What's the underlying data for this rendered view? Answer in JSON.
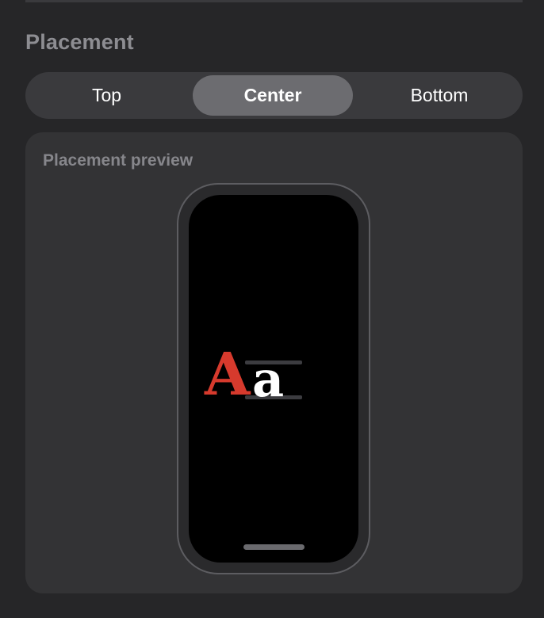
{
  "section": {
    "title": "Placement"
  },
  "placement_options": {
    "top": "Top",
    "center": "Center",
    "bottom": "Bottom",
    "selected": "Center"
  },
  "preview": {
    "title": "Placement preview",
    "glyph_capital": "A",
    "glyph_lower": "a",
    "capital_color": "#d63a2d",
    "lower_color": "#ffffff"
  }
}
